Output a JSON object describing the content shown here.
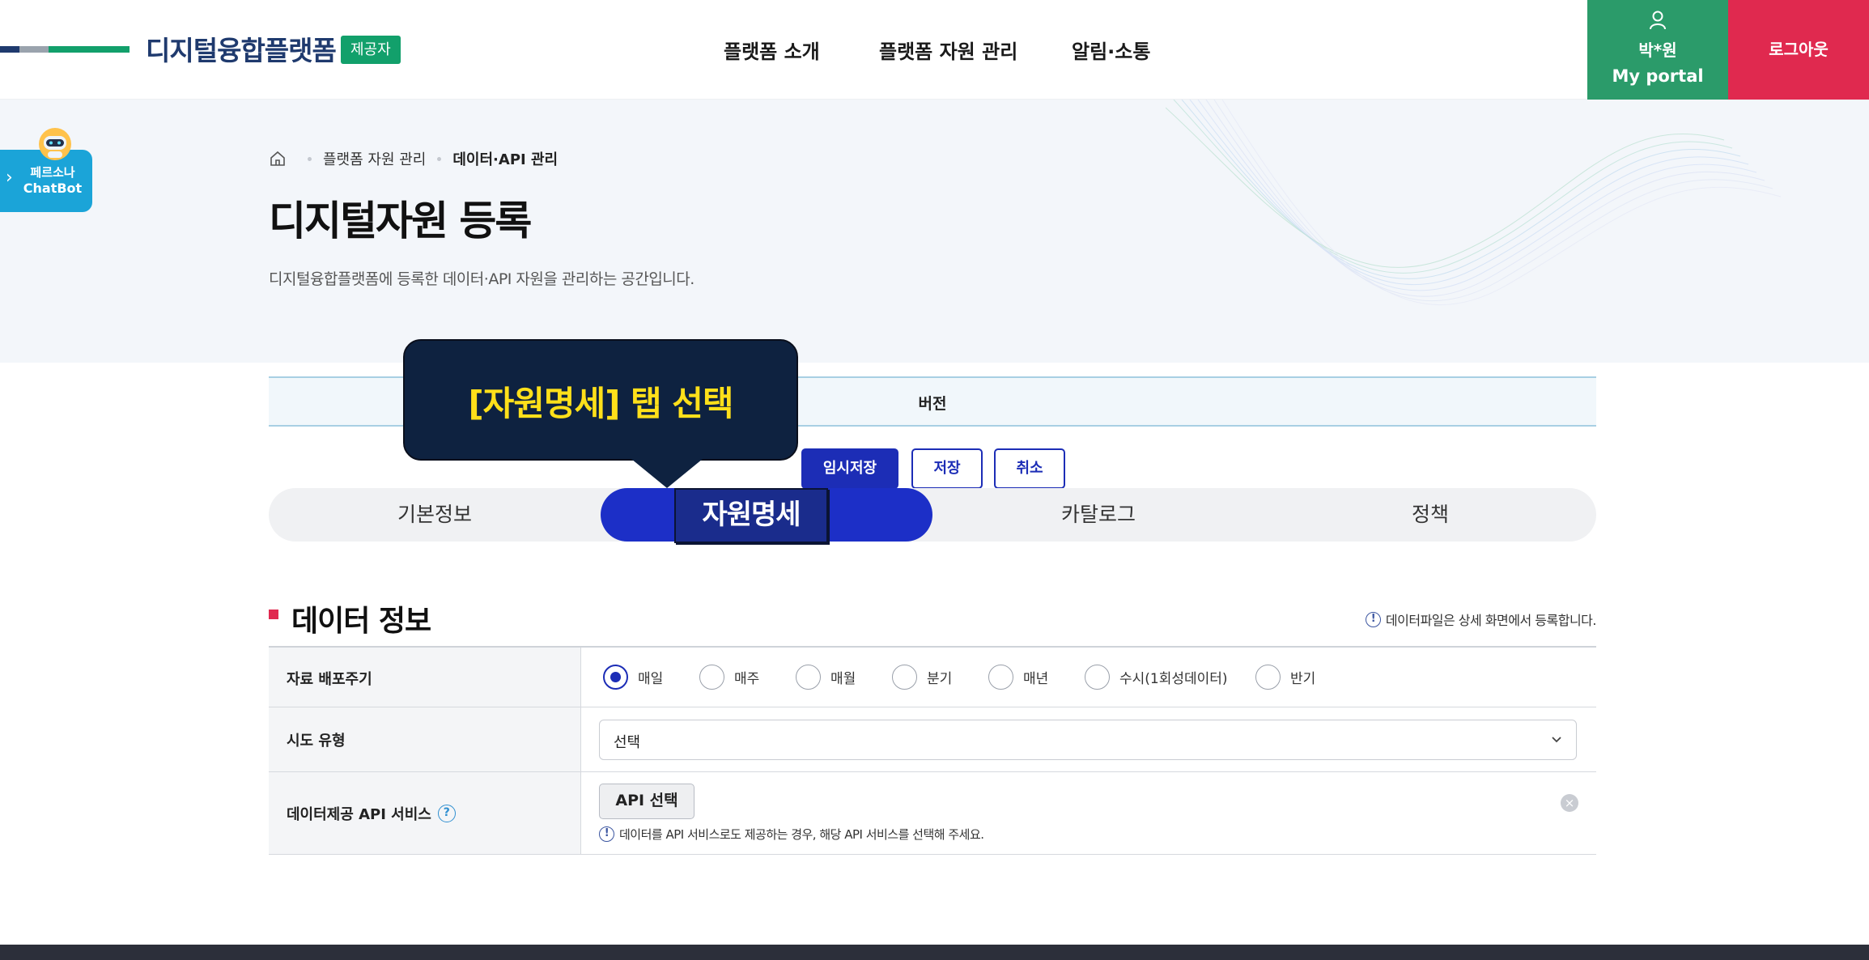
{
  "header": {
    "logo_text": "디지털융합플랫폼",
    "role_badge": "제공자",
    "nav": [
      "플랫폼 소개",
      "플랫폼 자원 관리",
      "알림·소통"
    ],
    "user_name": "박*원",
    "portal_label": "My portal",
    "logout_label": "로그아웃"
  },
  "chatbot": {
    "line1": "페르소나",
    "line2": "ChatBot"
  },
  "breadcrumb": {
    "items": [
      "플랫폼 자원 관리",
      "데이터·API 관리"
    ]
  },
  "page": {
    "title": "디지털자원 등록",
    "description": "디지털융합플랫폼에 등록한 데이터·API 자원을 관리하는 공간입니다."
  },
  "version_tab": {
    "label": "버전"
  },
  "actions": {
    "temp_save": "임시저장",
    "save": "저장",
    "cancel": "취소"
  },
  "steps": {
    "items": [
      "기본정보",
      "자원명세",
      "카탈로그",
      "정책"
    ],
    "active": "자원명세"
  },
  "callout": {
    "text": "[자원명세] 탭 선택"
  },
  "section": {
    "title": "데이터 정보",
    "note": "데이터파일은 상세 화면에서 등록합니다."
  },
  "form": {
    "cycle_label": "자료 배포주기",
    "cycle_options": [
      "매일",
      "매주",
      "매월",
      "분기",
      "매년",
      "수시(1회성데이터)",
      "반기"
    ],
    "cycle_selected": "매일",
    "region_label": "시도 유형",
    "region_value": "선택",
    "api_label": "데이터제공 API 서비스",
    "api_button": "API 선택",
    "api_help": "데이터를 API 서비스로도 제공하는 경우, 해당 API 서비스를 선택해 주세요."
  },
  "colors": {
    "brand_navy": "#1f3a6e",
    "badge_green": "#12a06b",
    "portal_green": "#2b9b6a",
    "logout_red": "#e0294f",
    "primary_blue": "#1c2db6",
    "callout_bg": "#0e2240",
    "callout_text": "#ffe01a"
  }
}
